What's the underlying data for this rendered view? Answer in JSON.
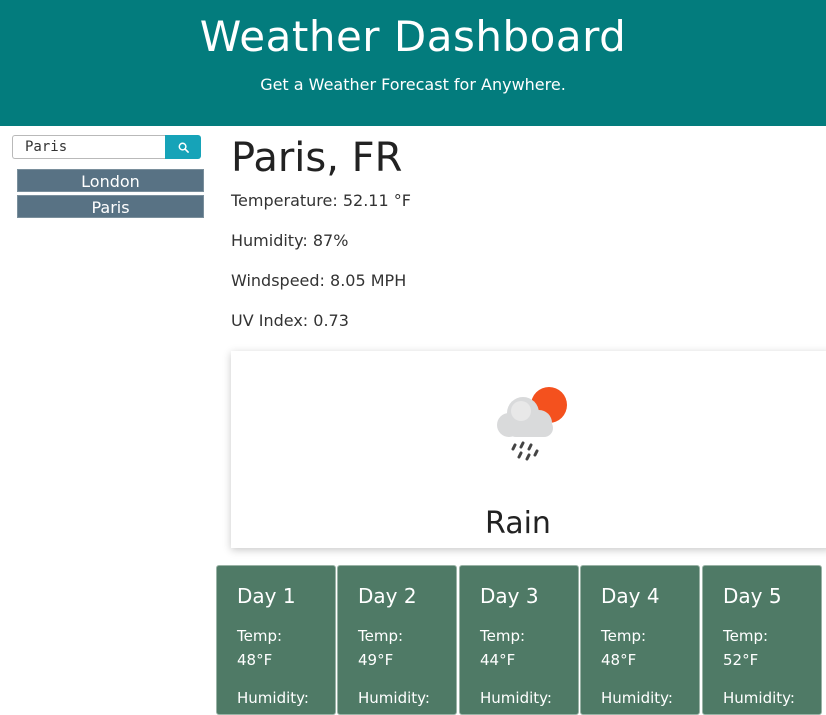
{
  "header": {
    "title": "Weather Dashboard",
    "subtitle": "Get a Weather Forecast for Anywhere."
  },
  "search": {
    "value": "Paris",
    "button_icon": "search-icon"
  },
  "history": [
    "London",
    "Paris"
  ],
  "current": {
    "city": "Paris, FR",
    "temperature": "Temperature: 52.11 °F",
    "humidity": "Humidity: 87%",
    "windspeed": "Windspeed: 8.05 MPH",
    "uv_index": "UV Index: 0.73",
    "condition": "Rain",
    "condition_icon": "rain-cloud-sun-icon"
  },
  "forecast": [
    {
      "day": "Day 1",
      "temp_label": "Temp:",
      "temp": "48°F",
      "humidity_label": "Humidity:"
    },
    {
      "day": "Day 2",
      "temp_label": "Temp:",
      "temp": "49°F",
      "humidity_label": "Humidity:"
    },
    {
      "day": "Day 3",
      "temp_label": "Temp:",
      "temp": "44°F",
      "humidity_label": "Humidity:"
    },
    {
      "day": "Day 4",
      "temp_label": "Temp:",
      "temp": "48°F",
      "humidity_label": "Humidity:"
    },
    {
      "day": "Day 5",
      "temp_label": "Temp:",
      "temp": "52°F",
      "humidity_label": "Humidity:"
    }
  ],
  "colors": {
    "header_bg": "#037c7d",
    "search_button": "#16a3b8",
    "history_item": "#587284",
    "forecast_card": "#4f7a66",
    "sun": "#f4511e"
  }
}
